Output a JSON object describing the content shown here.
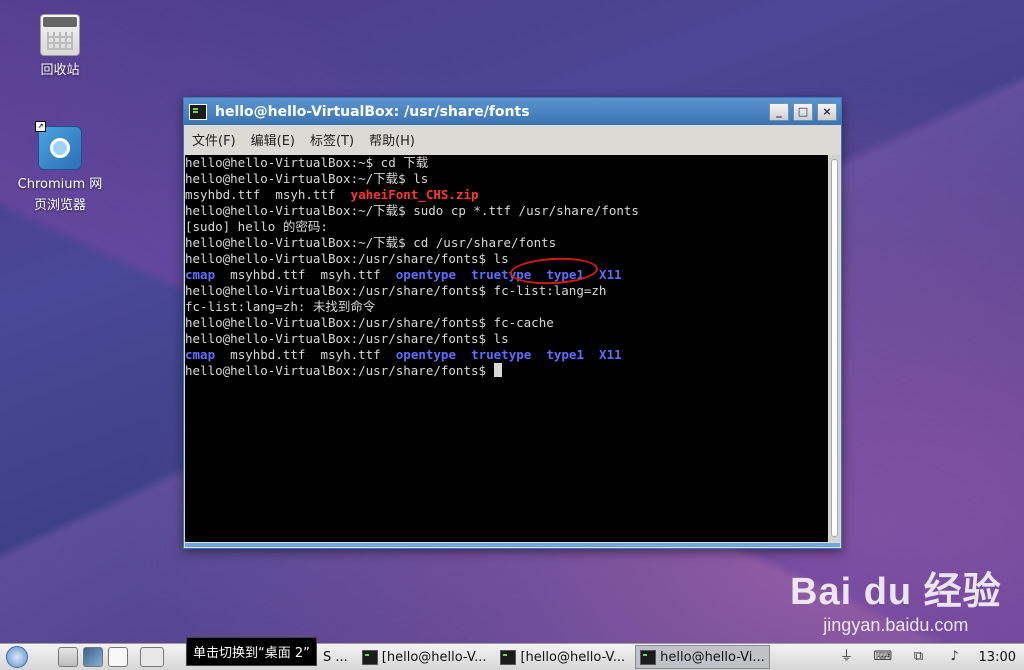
{
  "desktop": {
    "icons": [
      {
        "label": "回收站"
      },
      {
        "label": "Chromium 网页浏览器",
        "line1": "Chromium 网",
        "line2": "页浏览器"
      }
    ]
  },
  "window": {
    "title": "hello@hello-VirtualBox: /usr/share/fonts",
    "controls": {
      "minimize": "_",
      "maximize": "□",
      "close": "×"
    },
    "menu": [
      "文件(F)",
      "编辑(E)",
      "标签(T)",
      "帮助(H)"
    ]
  },
  "terminal": {
    "lines": [
      "hello@hello-VirtualBox:~$ cd 下载",
      "hello@hello-VirtualBox:~/下载$ ls",
      {
        "plain": "msyhbd.ttf  msyh.ttf  ",
        "red": "yaheiFont_CHS.zip"
      },
      "hello@hello-VirtualBox:~/下载$ sudo cp *.ttf /usr/share/fonts",
      "[sudo] hello 的密码:",
      "hello@hello-VirtualBox:~/下载$ cd /usr/share/fonts",
      "hello@hello-VirtualBox:/usr/share/fonts$ ls",
      {
        "listing": [
          "cmap",
          "msyhbd.ttf",
          "msyh.ttf",
          "opentype",
          "truetype",
          "type1",
          "X11"
        ]
      },
      "hello@hello-VirtualBox:/usr/share/fonts$ fc-list:lang=zh",
      "fc-list:lang=zh: 未找到命令",
      "hello@hello-VirtualBox:/usr/share/fonts$ fc-cache",
      "hello@hello-VirtualBox:/usr/share/fonts$ ls",
      {
        "listing": [
          "cmap",
          "msyhbd.ttf",
          "msyh.ttf",
          "opentype",
          "truetype",
          "type1",
          "X11"
        ]
      },
      {
        "prompt": "hello@hello-VirtualBox:/usr/share/fonts$ "
      }
    ],
    "blue_items": [
      "cmap",
      "opentype",
      "truetype",
      "type1",
      "X11"
    ]
  },
  "taskbar": {
    "tooltip": "单击切换到“桌面 2”",
    "tasks": [
      {
        "label": "S ..."
      },
      {
        "label": "[hello@hello-V..."
      },
      {
        "label": "[hello@hello-V..."
      },
      {
        "label": "hello@hello-Vi...",
        "active": true
      }
    ],
    "clock": "13:00"
  },
  "watermark": {
    "brand": "Bai du 经验",
    "url": "jingyan.baidu.com"
  }
}
